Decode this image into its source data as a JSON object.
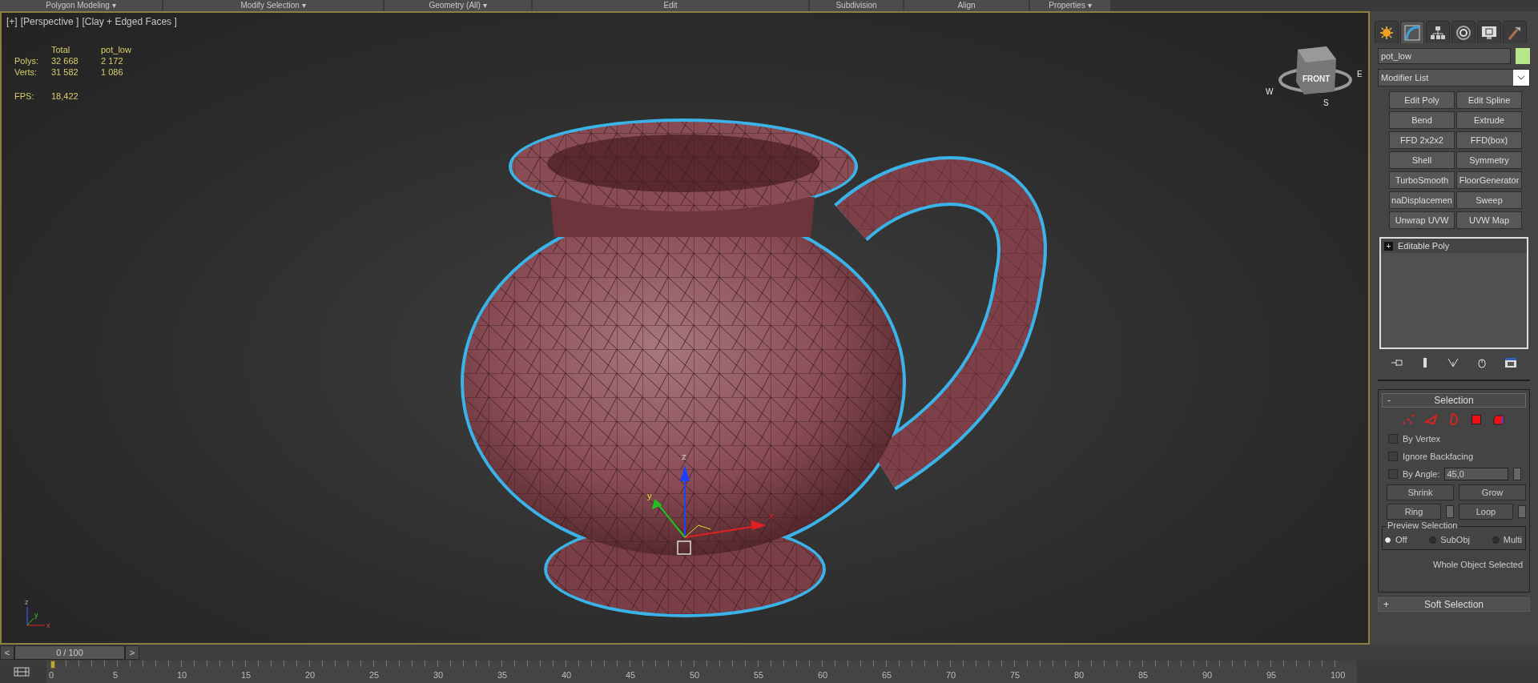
{
  "ribbon": [
    {
      "label": "Polygon Modeling",
      "arrow": "▾"
    },
    {
      "label": "Modify Selection",
      "arrow": "▾"
    },
    {
      "label": "Geometry (All)",
      "arrow": "▾"
    },
    {
      "label": "Edit"
    },
    {
      "label": "Subdivision"
    },
    {
      "label": "Align"
    },
    {
      "label": "Properties",
      "arrow": "▾"
    }
  ],
  "viewport": {
    "labels": [
      "[+]",
      "[Perspective ]",
      "[Clay + Edged Faces ]"
    ],
    "stats": {
      "headers": [
        "Total",
        "pot_low"
      ],
      "rows": [
        {
          "label": "Polys:",
          "values": [
            "32 668",
            "2 172"
          ]
        },
        {
          "label": "Verts:",
          "values": [
            "31 582",
            "1 086"
          ]
        }
      ],
      "fps_label": "FPS:",
      "fps": "18,422"
    },
    "viewcube": {
      "face": "FRONT",
      "compass": [
        "W",
        "S",
        "E"
      ]
    },
    "gizmo_axes": [
      "x",
      "y",
      "z"
    ],
    "tripod_axes": [
      "x",
      "y",
      "z"
    ]
  },
  "panel": {
    "tabs": [
      {
        "kind": "create",
        "selected": false
      },
      {
        "kind": "modify",
        "selected": true
      },
      {
        "kind": "hierarchy",
        "selected": false
      },
      {
        "kind": "motion",
        "selected": false
      },
      {
        "kind": "display",
        "selected": false
      },
      {
        "kind": "utilities",
        "selected": false
      }
    ],
    "object_name": "pot_low",
    "modifier_list": "Modifier List",
    "modifier_buttons": [
      "Edit Poly",
      "Edit Spline",
      "Bend",
      "Extrude",
      "FFD 2x2x2",
      "FFD(box)",
      "Shell",
      "Symmetry",
      "TurboSmooth",
      "FloorGenerator",
      "naDisplacemen",
      "Sweep",
      "Unwrap UVW",
      "UVW Map"
    ],
    "stack": [
      {
        "sign": "+",
        "label": "Editable Poly",
        "selected": false
      }
    ],
    "selection": {
      "sign": "-",
      "title": "Selection",
      "expanded": true,
      "subobjects": [
        {
          "kind": "vertex",
          "selected": false
        },
        {
          "kind": "edge",
          "selected": false
        },
        {
          "kind": "border",
          "selected": false
        },
        {
          "kind": "polygon",
          "selected": false
        },
        {
          "kind": "element",
          "selected": false
        }
      ],
      "checks": [
        {
          "label": "By Vertex",
          "checked": false
        },
        {
          "label": "Ignore Backfacing",
          "checked": false
        },
        {
          "label": "By Angle:",
          "checked": false,
          "value": "45,0"
        }
      ],
      "buttons": [
        "Shrink",
        "Grow"
      ],
      "spin_buttons": [
        "Ring",
        "Loop"
      ],
      "preview": {
        "title": "Preview Selection",
        "options": [
          {
            "label": "Off",
            "selected": true
          },
          {
            "label": "SubObj",
            "selected": false
          },
          {
            "label": "Multi",
            "selected": false
          }
        ]
      },
      "status": "Whole Object Selected"
    },
    "soft_selection": {
      "sign": "+",
      "title": "Soft Selection"
    }
  },
  "timeline": {
    "prev": "<",
    "position": "0 / 100",
    "next": ">",
    "level": 0,
    "ruler": [
      "0",
      "5",
      "10",
      "15",
      "20",
      "25",
      "30",
      "35",
      "40",
      "45",
      "50",
      "55",
      "60",
      "65",
      "70",
      "75",
      "80",
      "85",
      "90",
      "95",
      "100"
    ]
  }
}
